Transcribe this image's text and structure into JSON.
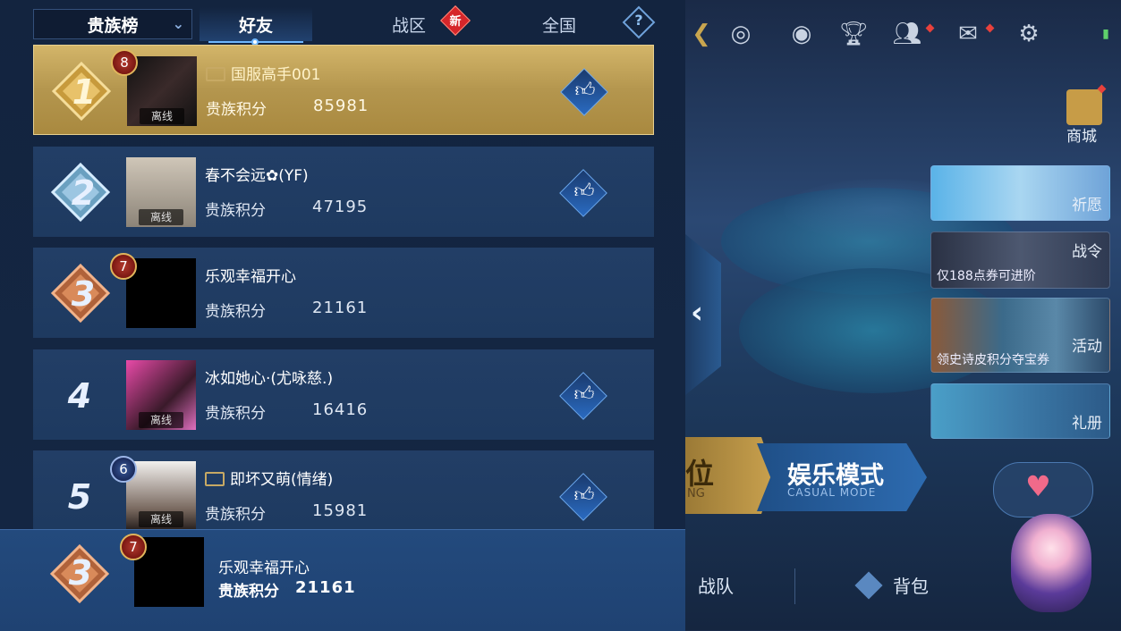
{
  "tabs": {
    "dropdown_label": "贵族榜",
    "friends": "好友",
    "region": "战区",
    "region_badge": "新",
    "national": "全国",
    "help": "?"
  },
  "rows": [
    {
      "rank": "1",
      "level": "8",
      "name": "国服高手001",
      "score_label": "贵族积分",
      "score": "85981",
      "status": "离线"
    },
    {
      "rank": "2",
      "level": "",
      "name": "春不会远✿(YF)",
      "score_label": "贵族积分",
      "score": "47195",
      "status": "离线"
    },
    {
      "rank": "3",
      "level": "7",
      "name": "乐观幸福开心",
      "score_label": "贵族积分",
      "score": "21161",
      "status": ""
    },
    {
      "rank": "4",
      "level": "",
      "name": "冰如她心·(尤咏慈.)",
      "score_label": "贵族积分",
      "score": "16416",
      "status": "离线"
    },
    {
      "rank": "5",
      "level": "6",
      "name": "即坏又萌(情绪)",
      "score_label": "贵族积分",
      "score": "15981",
      "status": "离线"
    }
  ],
  "self": {
    "rank": "3",
    "level": "7",
    "name": "乐观幸福开心",
    "score_label": "贵族积分",
    "score": "21161"
  },
  "side": {
    "shop": "商城",
    "wish": "祈愿",
    "battle_pass": "战令",
    "battle_pass_sub": "仅188点券可进阶",
    "event": "活动",
    "event_sub": "领史诗皮积分夺宝券",
    "gift": "礼册"
  },
  "modes": {
    "rank_partial": "位",
    "rank_sub_partial": "NG",
    "casual": "娱乐模式",
    "casual_sub": "CASUAL MODE"
  },
  "bottom_nav": {
    "team": "战队",
    "bag": "背包"
  },
  "colors": {
    "gold": "#c9a64f",
    "row_blue": "#213d64",
    "accent": "#6fb7ff",
    "red_dot": "#e8413c"
  }
}
